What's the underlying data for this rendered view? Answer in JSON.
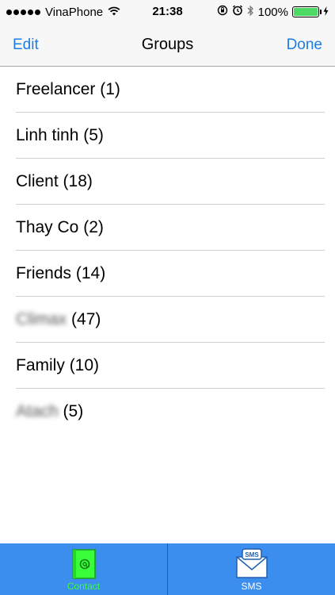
{
  "status_bar": {
    "carrier": "VinaPhone",
    "time": "21:38",
    "battery": "100%"
  },
  "nav": {
    "left_label": "Edit",
    "title": "Groups",
    "right_label": "Done"
  },
  "groups": [
    {
      "name": "Freelancer",
      "count": "(1)"
    },
    {
      "name": "Linh tinh",
      "count": "(5)"
    },
    {
      "name": "Client",
      "count": "(18)"
    },
    {
      "name": "Thay Co",
      "count": "(2)"
    },
    {
      "name": "Friends",
      "count": "(14)"
    },
    {
      "name": "Climax",
      "count": "(47)"
    },
    {
      "name": "Family",
      "count": "(10)"
    },
    {
      "name": "Atach",
      "count": "(5)"
    }
  ],
  "tab_bar": {
    "contact_label": "Contact",
    "sms_label": "SMS",
    "sms_badge": "SMS"
  },
  "colors": {
    "accent": "#1a7ee6",
    "tab_bar": "#3b8dee",
    "contact_active": "#39ff3a",
    "battery": "#4cd964"
  }
}
